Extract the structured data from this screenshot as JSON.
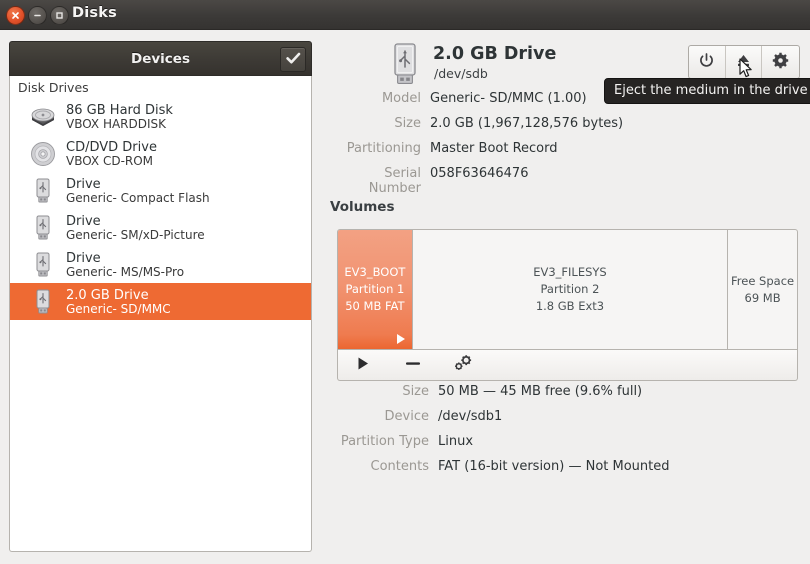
{
  "window": {
    "title": "Disks",
    "controls": {
      "close": "close-button",
      "minimize": "minimize-button",
      "maximize": "maximize-button"
    }
  },
  "sidebar": {
    "header_title": "Devices",
    "header_button_icon": "check-icon",
    "group_label": "Disk Drives",
    "items": [
      {
        "name": "86 GB Hard Disk",
        "sub": "VBOX HARDDISK",
        "icon": "hard-disk-icon",
        "selected": false
      },
      {
        "name": "CD/DVD Drive",
        "sub": "VBOX CD-ROM",
        "icon": "optical-disc-icon",
        "selected": false
      },
      {
        "name": "Drive",
        "sub": "Generic- Compact Flash",
        "icon": "usb-drive-icon",
        "selected": false
      },
      {
        "name": "Drive",
        "sub": "Generic- SM/xD-Picture",
        "icon": "usb-drive-icon",
        "selected": false
      },
      {
        "name": "Drive",
        "sub": "Generic- MS/MS-Pro",
        "icon": "usb-drive-icon",
        "selected": false
      },
      {
        "name": "2.0 GB Drive",
        "sub": "Generic- SD/MMC",
        "icon": "usb-drive-icon",
        "selected": true
      }
    ]
  },
  "drive": {
    "icon": "usb-drive-icon",
    "title": "2.0 GB Drive",
    "device": "/dev/sdb",
    "properties": [
      {
        "label": "Model",
        "value": "Generic- SD/MMC (1.00)"
      },
      {
        "label": "Size",
        "value": "2.0 GB (1,967,128,576 bytes)"
      },
      {
        "label": "Partitioning",
        "value": "Master Boot Record"
      },
      {
        "label": "Serial Number",
        "value": "058F63646476"
      }
    ],
    "toolbar": [
      {
        "icon": "power-icon",
        "name": "power-off-button"
      },
      {
        "icon": "eject-icon",
        "name": "eject-button"
      },
      {
        "icon": "gear-icon",
        "name": "drive-settings-button"
      }
    ]
  },
  "tooltip": {
    "text": "Eject the medium in the drive"
  },
  "volumes": {
    "section_title": "Volumes",
    "items": [
      {
        "label": "EV3_BOOT",
        "line2": "Partition 1",
        "line3": "50 MB FAT",
        "selected": true,
        "width_pct": 16.3
      },
      {
        "label": "EV3_FILESYS",
        "line2": "Partition 2",
        "line3": "1.8 GB Ext3",
        "selected": false,
        "width_pct": 68.7
      },
      {
        "label": "Free Space",
        "line2": "69 MB",
        "line3": "",
        "selected": false,
        "width_pct": 15.0
      }
    ],
    "toolbar": [
      {
        "icon": "play-icon",
        "name": "mount-volume-button"
      },
      {
        "icon": "minus-icon",
        "name": "delete-partition-button"
      },
      {
        "icon": "gears-icon",
        "name": "more-actions-button"
      }
    ]
  },
  "partition": {
    "properties": [
      {
        "label": "Size",
        "value": "50 MB — 45 MB free (9.6% full)"
      },
      {
        "label": "Device",
        "value": "/dev/sdb1"
      },
      {
        "label": "Partition Type",
        "value": "Linux"
      },
      {
        "label": "Contents",
        "value": "FAT (16-bit version) — Not Mounted"
      }
    ]
  },
  "colors": {
    "selection": "#ee6a33",
    "partition_selected": "#ef7b4f",
    "background": "#f0efee",
    "titlebar": "#3c3a38",
    "tooltip_bg": "#262423"
  }
}
